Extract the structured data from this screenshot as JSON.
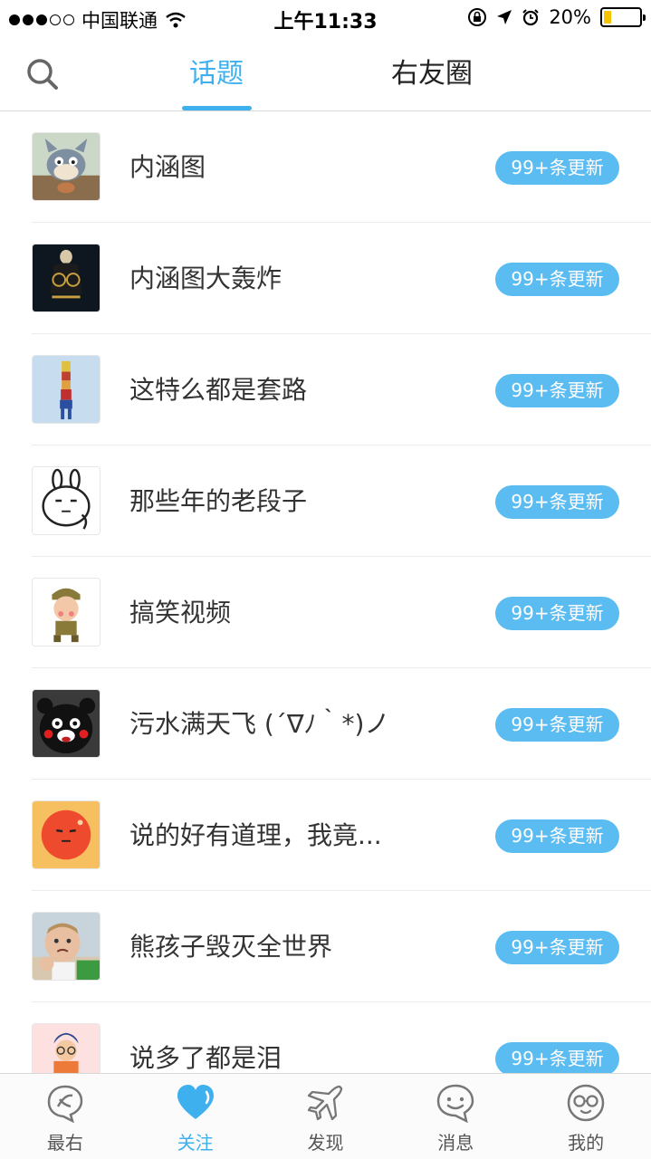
{
  "status_bar": {
    "carrier": "中国联通",
    "time": "上午11:33",
    "battery": "20%",
    "signal_dots_filled": 3,
    "signal_dots_total": 5,
    "battery_level": 0.2
  },
  "header": {
    "tabs": [
      {
        "label": "话题",
        "active": true
      },
      {
        "label": "右友圈",
        "active": false
      }
    ]
  },
  "topics": [
    {
      "title": "内涵图",
      "badge": "99+条更新",
      "icon": "cartoon-cat-thumbnail"
    },
    {
      "title": "内涵图大轰炸",
      "badge": "99+条更新",
      "icon": "dark-poster-thumbnail"
    },
    {
      "title": "这特么都是套路",
      "badge": "99+条更新",
      "icon": "stacked-figures-thumbnail"
    },
    {
      "title": "那些年的老段子",
      "badge": "99+条更新",
      "icon": "rabbit-face-thumbnail"
    },
    {
      "title": "搞笑视频",
      "badge": "99+条更新",
      "icon": "cartoon-soldier-thumbnail"
    },
    {
      "title": "污水满天飞 (´∇ﾉ｀*)ノ",
      "badge": "99+条更新",
      "icon": "kumamon-thumbnail"
    },
    {
      "title": "说的好有道理，我竟...",
      "badge": "99+条更新",
      "icon": "red-face-thumbnail"
    },
    {
      "title": "熊孩子毁灭全世界",
      "badge": "99+条更新",
      "icon": "baby-fist-thumbnail"
    },
    {
      "title": "说多了都是泪",
      "badge": "99+条更新",
      "icon": "cartoon-boy-thumbnail"
    }
  ],
  "tabbar": [
    {
      "label": "最右",
      "icon": "zuiyou-icon",
      "active": false
    },
    {
      "label": "关注",
      "icon": "heart-icon",
      "active": true
    },
    {
      "label": "发现",
      "icon": "airplane-icon",
      "active": false
    },
    {
      "label": "消息",
      "icon": "message-bubble-icon",
      "active": false
    },
    {
      "label": "我的",
      "icon": "glasses-face-icon",
      "active": false
    }
  ],
  "colors": {
    "accent": "#3fb0ee",
    "badge": "#5bbcf2",
    "text": "#333333"
  }
}
